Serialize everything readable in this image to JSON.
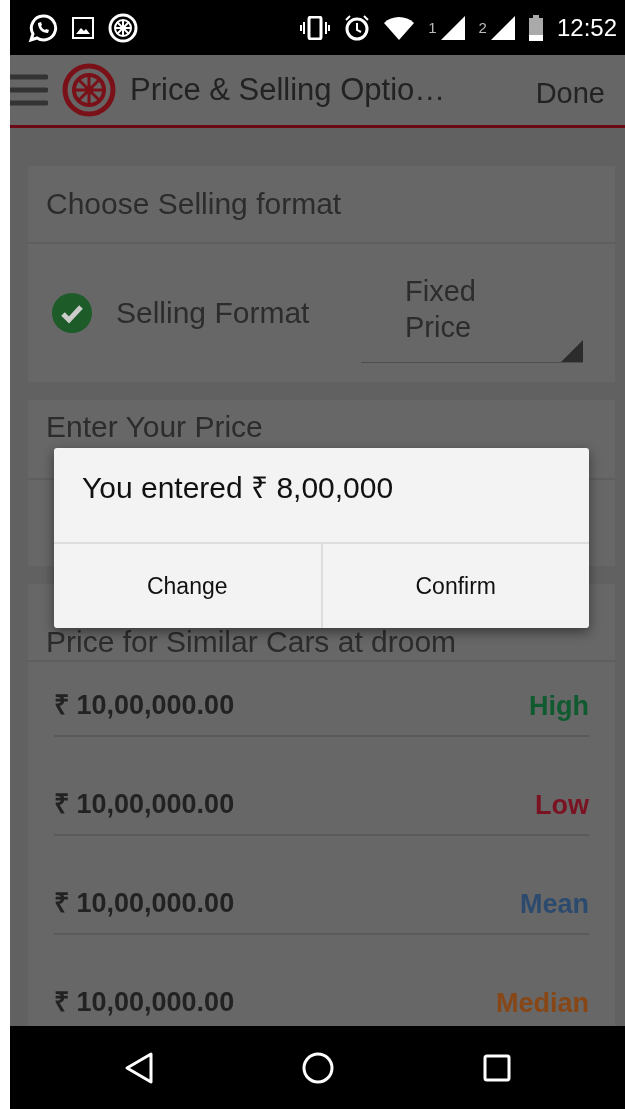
{
  "status_bar": {
    "time": "12:52",
    "sims": [
      "1",
      "2"
    ]
  },
  "app_bar": {
    "title": "Price & Selling Optio…",
    "action": "Done"
  },
  "sections": [
    {
      "kind": "format",
      "title": "Choose Selling format",
      "label": "Selling Format",
      "checked": true,
      "value": "Fixed Price"
    },
    {
      "kind": "entry",
      "title": "Enter Your Price"
    },
    {
      "kind": "prices",
      "title": "Price for Similar Cars at droom",
      "rows": [
        {
          "price": "₹ 10,00,000.00",
          "tag": "High",
          "color": "#0f5a2e"
        },
        {
          "price": "₹ 10,00,000.00",
          "tag": "Low",
          "color": "#7a1222"
        },
        {
          "price": "₹ 10,00,000.00",
          "tag": "Mean",
          "color": "#2c4a6e"
        },
        {
          "price": "₹ 10,00,000.00",
          "tag": "Median",
          "color": "#874616"
        }
      ]
    }
  ],
  "dialog": {
    "message": "You entered ₹ 8,00,000",
    "buttons": [
      "Change",
      "Confirm"
    ]
  }
}
